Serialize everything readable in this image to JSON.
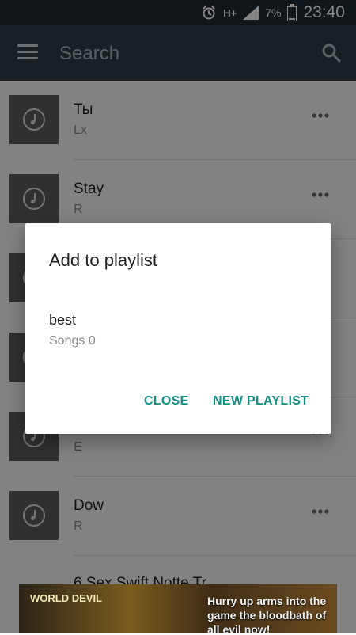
{
  "status": {
    "battery_percent": "7%",
    "network": "H+",
    "time": "23:40"
  },
  "header": {
    "search_placeholder": "Search"
  },
  "songs": [
    {
      "title": "Ты",
      "subtitle": "Lx"
    },
    {
      "title": "Stay",
      "subtitle": "R"
    },
    {
      "title": "",
      "subtitle": ""
    },
    {
      "title": "",
      "subtitle": ""
    },
    {
      "title": "",
      "subtitle": "E"
    },
    {
      "title": "Dow",
      "subtitle": "R"
    },
    {
      "title": "6 Sex Swift Notte Tr...",
      "subtitle": ""
    }
  ],
  "ad": {
    "logo_text": "WORLD DEVIL",
    "text": "Hurry up arms into the game the bloodbath of all evil now!"
  },
  "dialog": {
    "title": "Add to playlist",
    "playlist": {
      "name": "best",
      "count_text": "Songs 0"
    },
    "close_label": "CLOSE",
    "new_playlist_label": "NEW PLAYLIST"
  },
  "colors": {
    "accent": "#128f86",
    "appbar": "#2e3f48",
    "statusbar": "#1f2b31"
  }
}
